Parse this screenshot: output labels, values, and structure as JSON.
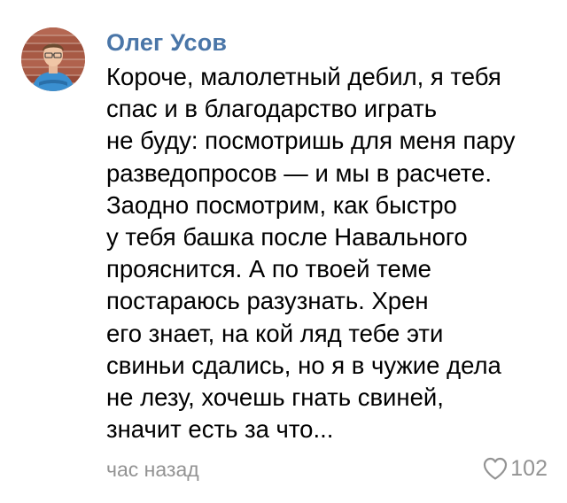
{
  "comment": {
    "author": "Олег Усов",
    "avatar_icon": "user-photo",
    "text_lines": [
      "Короче, малолетный дебил, я тебя",
      "спас и в благодарство играть",
      "не буду: посмотришь для меня пару",
      "разведопросов — и мы в расчете.",
      "Заодно посмотрим, как быстро",
      "у тебя башка после Навального",
      "прояснится. А по твоей теме",
      "постараюсь разузнать. Хрен",
      "его знает, на кой ляд тебе эти",
      "свиньи сдались, но я в чужие дела",
      "не лезу, хочешь гнать свиней,",
      "значит есть за что..."
    ],
    "time": "час назад",
    "likes": {
      "icon": "heart-icon",
      "count": "102"
    },
    "colors": {
      "author": "#4a76a8",
      "meta": "#939393",
      "text": "#000000"
    }
  }
}
